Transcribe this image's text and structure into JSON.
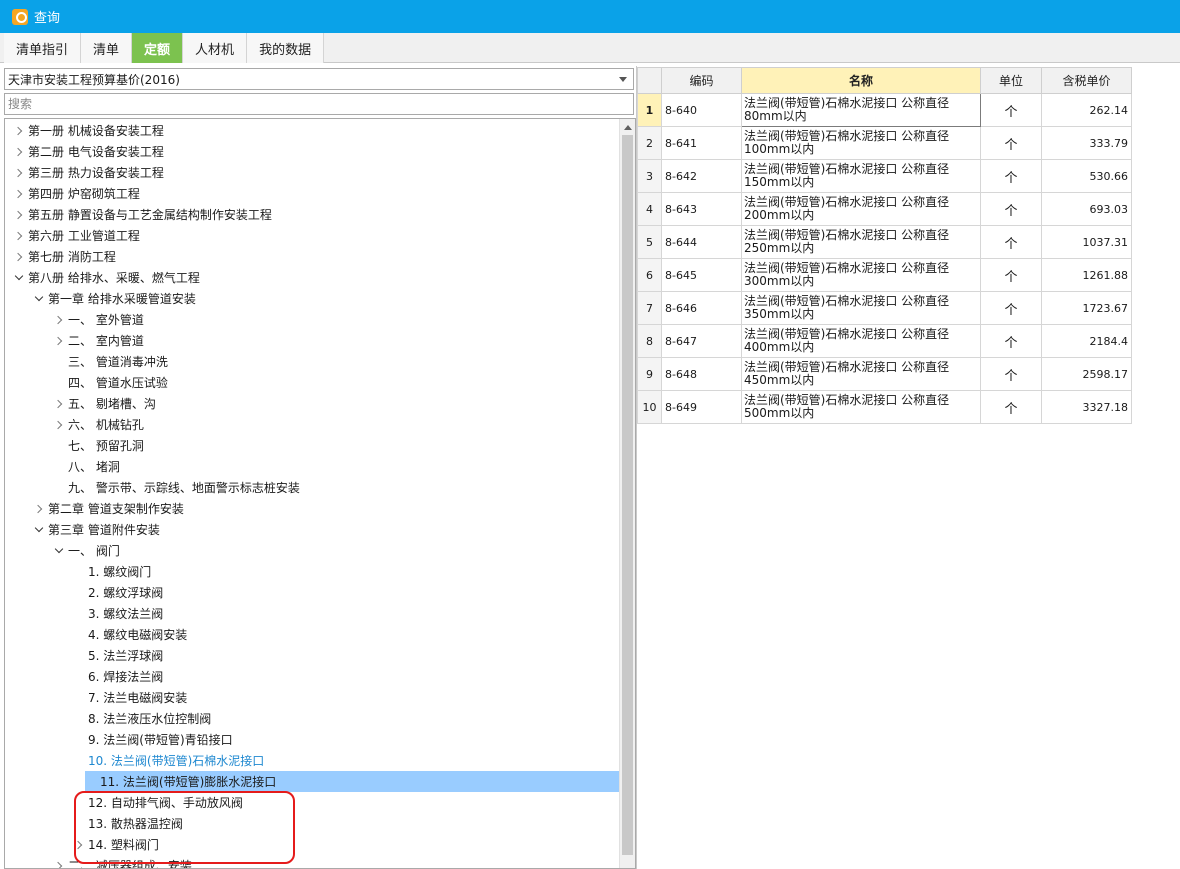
{
  "window": {
    "title": "查询"
  },
  "tabs": [
    {
      "label": "清单指引",
      "active": false
    },
    {
      "label": "清单",
      "active": false
    },
    {
      "label": "定额",
      "active": true
    },
    {
      "label": "人材机",
      "active": false
    },
    {
      "label": "我的数据",
      "active": false
    }
  ],
  "library_select": {
    "value": "天津市安装工程预算基价(2016)"
  },
  "search": {
    "placeholder": "搜索"
  },
  "tree": [
    {
      "label": "第一册 机械设备安装工程",
      "level": 0,
      "state": "collapsed"
    },
    {
      "label": "第二册 电气设备安装工程",
      "level": 0,
      "state": "collapsed"
    },
    {
      "label": "第三册 热力设备安装工程",
      "level": 0,
      "state": "collapsed"
    },
    {
      "label": "第四册 炉窑砌筑工程",
      "level": 0,
      "state": "collapsed"
    },
    {
      "label": "第五册 静置设备与工艺金属结构制作安装工程",
      "level": 0,
      "state": "collapsed"
    },
    {
      "label": "第六册 工业管道工程",
      "level": 0,
      "state": "collapsed"
    },
    {
      "label": "第七册 消防工程",
      "level": 0,
      "state": "collapsed"
    },
    {
      "label": "第八册 给排水、采暖、燃气工程",
      "level": 0,
      "state": "expanded"
    },
    {
      "label": "第一章 给排水采暖管道安装",
      "level": 1,
      "state": "expanded"
    },
    {
      "label": "一、 室外管道",
      "level": 2,
      "state": "collapsed"
    },
    {
      "label": "二、 室内管道",
      "level": 2,
      "state": "collapsed"
    },
    {
      "label": "三、 管道消毒冲洗",
      "level": 2,
      "state": "leaf"
    },
    {
      "label": "四、 管道水压试验",
      "level": 2,
      "state": "leaf"
    },
    {
      "label": "五、 剔堵槽、沟",
      "level": 2,
      "state": "collapsed"
    },
    {
      "label": "六、 机械钻孔",
      "level": 2,
      "state": "collapsed"
    },
    {
      "label": "七、 预留孔洞",
      "level": 2,
      "state": "leaf"
    },
    {
      "label": "八、 堵洞",
      "level": 2,
      "state": "leaf"
    },
    {
      "label": "九、 警示带、示踪线、地面警示标志桩安装",
      "level": 2,
      "state": "leaf"
    },
    {
      "label": "第二章 管道支架制作安装",
      "level": 1,
      "state": "collapsed"
    },
    {
      "label": "第三章 管道附件安装",
      "level": 1,
      "state": "expanded"
    },
    {
      "label": "一、 阀门",
      "level": 2,
      "state": "expanded"
    },
    {
      "label": "1. 螺纹阀门",
      "level": 3,
      "state": "leaf"
    },
    {
      "label": "2. 螺纹浮球阀",
      "level": 3,
      "state": "leaf"
    },
    {
      "label": "3. 螺纹法兰阀",
      "level": 3,
      "state": "leaf"
    },
    {
      "label": "4. 螺纹电磁阀安装",
      "level": 3,
      "state": "leaf"
    },
    {
      "label": "5. 法兰浮球阀",
      "level": 3,
      "state": "leaf"
    },
    {
      "label": "6. 焊接法兰阀",
      "level": 3,
      "state": "leaf"
    },
    {
      "label": "7. 法兰电磁阀安装",
      "level": 3,
      "state": "leaf"
    },
    {
      "label": "8. 法兰液压水位控制阀",
      "level": 3,
      "state": "leaf"
    },
    {
      "label": "9. 法兰阀(带短管)青铅接口",
      "level": 3,
      "state": "leaf"
    },
    {
      "label": "10. 法兰阀(带短管)石棉水泥接口",
      "level": 3,
      "state": "leaf",
      "selected": true
    },
    {
      "label": "11. 法兰阀(带短管)膨胀水泥接口",
      "level": 3,
      "state": "leaf",
      "highlighted": true
    },
    {
      "label": "12. 自动排气阀、手动放风阀",
      "level": 3,
      "state": "leaf"
    },
    {
      "label": "13. 散热器温控阀",
      "level": 3,
      "state": "leaf"
    },
    {
      "label": "14. 塑料阀门",
      "level": 3,
      "state": "collapsed"
    },
    {
      "label": "二、 减压器组成、安装",
      "level": 2,
      "state": "collapsed"
    }
  ],
  "table": {
    "headers": {
      "code": "编码",
      "name": "名称",
      "unit": "单位",
      "price": "含税单价"
    },
    "rows": [
      {
        "idx": "1",
        "code": "8-640",
        "name": "法兰阀(带短管)石棉水泥接口 公称直径80mm以内",
        "unit": "个",
        "price": "262.14"
      },
      {
        "idx": "2",
        "code": "8-641",
        "name": "法兰阀(带短管)石棉水泥接口 公称直径100mm以内",
        "unit": "个",
        "price": "333.79"
      },
      {
        "idx": "3",
        "code": "8-642",
        "name": "法兰阀(带短管)石棉水泥接口 公称直径150mm以内",
        "unit": "个",
        "price": "530.66"
      },
      {
        "idx": "4",
        "code": "8-643",
        "name": "法兰阀(带短管)石棉水泥接口 公称直径200mm以内",
        "unit": "个",
        "price": "693.03"
      },
      {
        "idx": "5",
        "code": "8-644",
        "name": "法兰阀(带短管)石棉水泥接口 公称直径250mm以内",
        "unit": "个",
        "price": "1037.31"
      },
      {
        "idx": "6",
        "code": "8-645",
        "name": "法兰阀(带短管)石棉水泥接口 公称直径300mm以内",
        "unit": "个",
        "price": "1261.88"
      },
      {
        "idx": "7",
        "code": "8-646",
        "name": "法兰阀(带短管)石棉水泥接口 公称直径350mm以内",
        "unit": "个",
        "price": "1723.67"
      },
      {
        "idx": "8",
        "code": "8-647",
        "name": "法兰阀(带短管)石棉水泥接口 公称直径400mm以内",
        "unit": "个",
        "price": "2184.4"
      },
      {
        "idx": "9",
        "code": "8-648",
        "name": "法兰阀(带短管)石棉水泥接口 公称直径450mm以内",
        "unit": "个",
        "price": "2598.17"
      },
      {
        "idx": "10",
        "code": "8-649",
        "name": "法兰阀(带短管)石棉水泥接口 公称直径500mm以内",
        "unit": "个",
        "price": "3327.18"
      }
    ]
  },
  "colors": {
    "titlebar": "#0aa2e8",
    "active_tab": "#7cc24f",
    "highlight_row": "#99ccff",
    "selected_text": "#1e88d0",
    "annotation": "#e51b1b",
    "header_highlight": "#fff2b8"
  }
}
